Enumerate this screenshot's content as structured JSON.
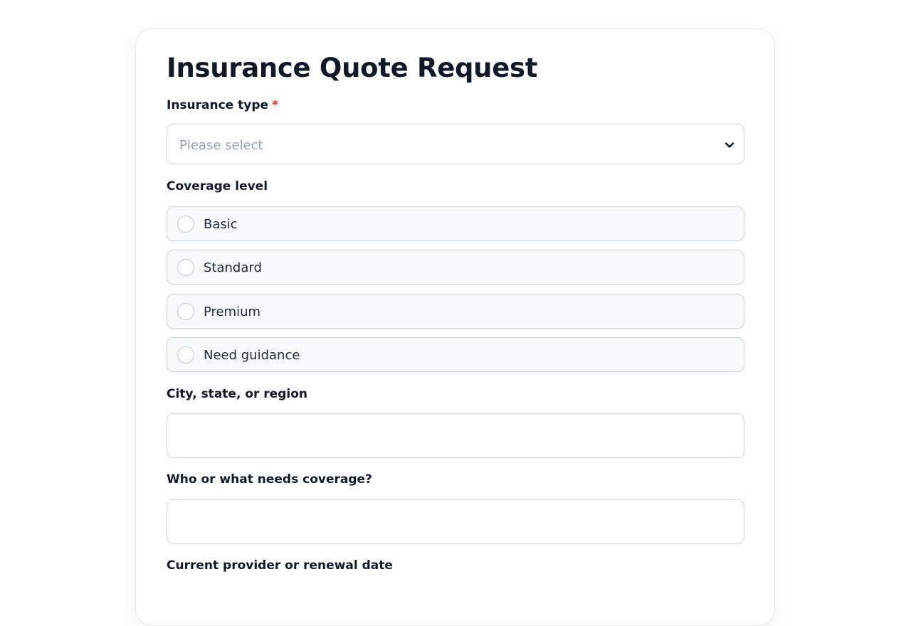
{
  "form": {
    "title": "Insurance Quote Request",
    "insurance_type": {
      "label": "Insurance type",
      "required_mark": "*",
      "placeholder": "Please select"
    },
    "coverage_level": {
      "label": "Coverage level",
      "options": [
        "Basic",
        "Standard",
        "Premium",
        "Need guidance"
      ]
    },
    "location": {
      "label": "City, state, or region",
      "value": ""
    },
    "coverage_subject": {
      "label": "Who or what needs coverage?",
      "value": ""
    },
    "current_provider": {
      "label": "Current provider or renewal date"
    }
  },
  "icons": {
    "select_arrow": "chevron-down-icon"
  },
  "colors": {
    "text": "#111827",
    "required": "#d92d20",
    "placeholder": "#98a2b3",
    "border": "#d0d5dd",
    "option_background": "#f8f9fb"
  }
}
